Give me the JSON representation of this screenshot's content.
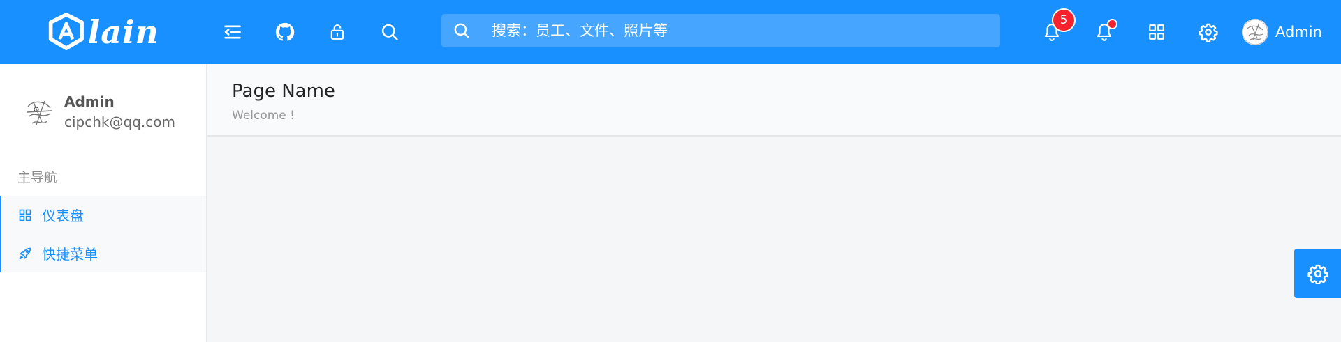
{
  "header": {
    "logo_text": "lain",
    "search_placeholder": "搜索：员工、文件、照片等",
    "notice_count": "5",
    "username": "Admin"
  },
  "icons": {
    "menu_fold": "menu-fold-icon",
    "github": "github-icon",
    "lock": "lock-icon",
    "search": "search-icon",
    "notice": "bell-icon",
    "task": "bell-icon",
    "apps": "appstore-icon",
    "setting": "gear-icon",
    "dashboard": "appstore-icon",
    "rocket": "rocket-icon"
  },
  "sidebar": {
    "user_name": "Admin",
    "user_email": "cipchk@qq.com",
    "group_title": "主导航",
    "items": [
      {
        "label": "仪表盘"
      },
      {
        "label": "快捷菜单"
      }
    ]
  },
  "page": {
    "title": "Page Name",
    "subtitle": "Welcome !"
  },
  "colors": {
    "primary": "#1890ff",
    "badge": "#f5222d",
    "background": "#f5f6f8"
  }
}
